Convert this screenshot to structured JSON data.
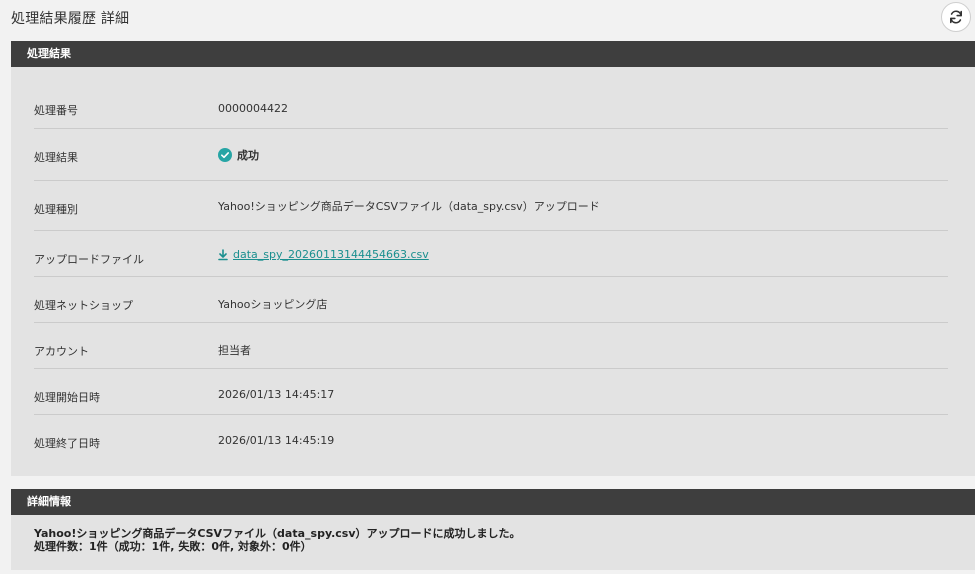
{
  "header": {
    "title": "処理結果履歴 詳細"
  },
  "result_section": {
    "title": "処理結果",
    "rows": [
      {
        "label": "処理番号",
        "value": "0000004422"
      },
      {
        "label": "処理結果",
        "value": "成功"
      },
      {
        "label": "処理種別",
        "value": "Yahoo!ショッピング商品データCSVファイル（data_spy.csv）アップロード"
      },
      {
        "label": "アップロードファイル",
        "value": "data_spy_20260113144454663.csv"
      },
      {
        "label": "処理ネットショップ",
        "value": "Yahooショッピング店"
      },
      {
        "label": "アカウント",
        "value": "担当者"
      },
      {
        "label": "処理開始日時",
        "value": "2026/01/13 14:45:17"
      },
      {
        "label": "処理終了日時",
        "value": "2026/01/13 14:45:19"
      }
    ]
  },
  "detail_section": {
    "title": "詳細情報",
    "line1": "Yahoo!ショッピング商品データCSVファイル（data_spy.csv）アップロードに成功しました。",
    "line2": "処理件数：1件（成功：1件, 失敗：0件, 対象外：0件）"
  },
  "colors": {
    "section_header": "#3e3e3e",
    "section_body": "#e3e3e3",
    "success_icon": "#27a5a5",
    "link": "#1a8f8f"
  },
  "icons": {
    "refresh": "refresh-icon",
    "success": "check-circle-icon",
    "download": "download-icon"
  }
}
